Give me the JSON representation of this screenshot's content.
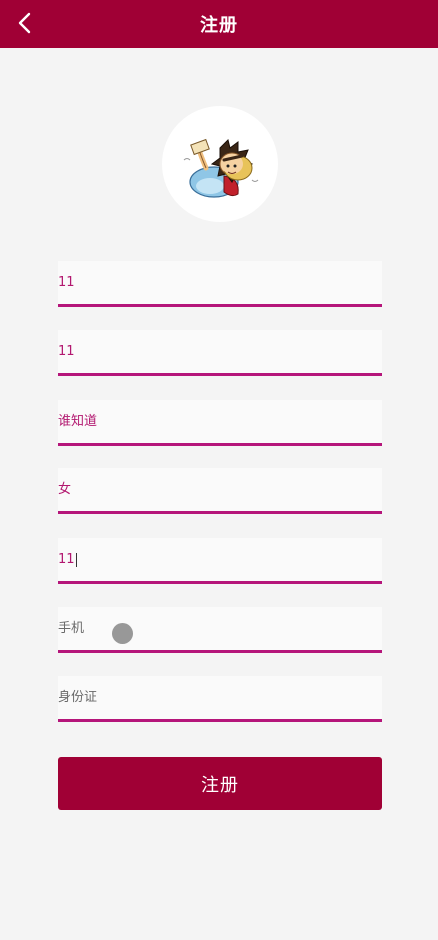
{
  "header": {
    "title": "注册",
    "back_icon": "chevron-left-icon"
  },
  "avatar": {
    "icon": "cartoon-avatar-icon"
  },
  "form": {
    "fields": [
      {
        "value": "11",
        "placeholder": ""
      },
      {
        "value": "11",
        "placeholder": ""
      },
      {
        "value": "谁知道",
        "placeholder": ""
      },
      {
        "value": "女",
        "placeholder": ""
      },
      {
        "value": "11",
        "placeholder": ""
      },
      {
        "value": "",
        "placeholder": "手机"
      },
      {
        "value": "",
        "placeholder": "身份证"
      }
    ],
    "submit_label": "注册"
  },
  "colors": {
    "brand": "#a00035",
    "underline": "#b5157a",
    "value_text": "#b2176f"
  }
}
